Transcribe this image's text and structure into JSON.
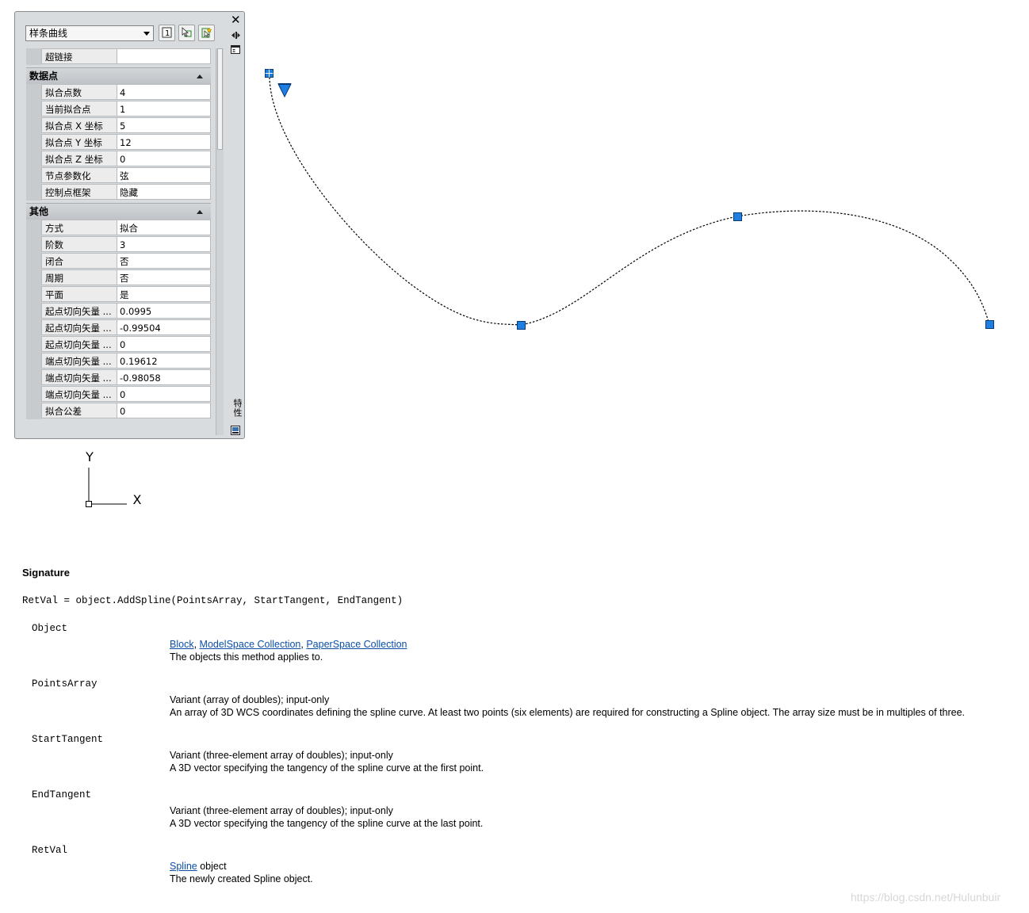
{
  "palette": {
    "object_type": "样条曲线",
    "title": "特性",
    "general_rows": [
      {
        "key": "超链接",
        "value": ""
      }
    ],
    "categories": [
      {
        "name": "数据点",
        "rows": [
          {
            "key": "拟合点数",
            "value": "4"
          },
          {
            "key": "当前拟合点",
            "value": "1"
          },
          {
            "key": "拟合点 X 坐标",
            "value": "5"
          },
          {
            "key": "拟合点 Y 坐标",
            "value": "12"
          },
          {
            "key": "拟合点 Z 坐标",
            "value": "0"
          },
          {
            "key": "节点参数化",
            "value": "弦"
          },
          {
            "key": "控制点框架",
            "value": "隐藏"
          }
        ]
      },
      {
        "name": "其他",
        "rows": [
          {
            "key": "方式",
            "value": "拟合"
          },
          {
            "key": "阶数",
            "value": "3"
          },
          {
            "key": "闭合",
            "value": "否"
          },
          {
            "key": "周期",
            "value": "否"
          },
          {
            "key": "平面",
            "value": "是"
          },
          {
            "key": "起点切向矢量 ...",
            "value": "0.0995"
          },
          {
            "key": "起点切向矢量 ...",
            "value": "-0.99504"
          },
          {
            "key": "起点切向矢量 ...",
            "value": "0"
          },
          {
            "key": "端点切向矢量 ...",
            "value": "0.19612"
          },
          {
            "key": "端点切向矢量 ...",
            "value": "-0.98058"
          },
          {
            "key": "端点切向矢量 ...",
            "value": "0"
          },
          {
            "key": "拟合公差",
            "value": "0"
          }
        ]
      }
    ],
    "icons": [
      "pickadd-toggle-icon",
      "select-objects-icon",
      "quick-select-icon",
      "close-icon",
      "autohide-icon",
      "properties-menu-icon"
    ]
  },
  "ucs": {
    "x_label": "X",
    "y_label": "Y"
  },
  "doc": {
    "heading": "Signature",
    "syntax": "RetVal = object.AddSpline(PointsArray, StartTangent, EndTangent)",
    "params": [
      {
        "name": "Object",
        "links": [
          "Block",
          "ModelSpace Collection",
          "PaperSpace Collection"
        ],
        "line2": "The objects this method applies to."
      },
      {
        "name": "PointsArray",
        "line1": "Variant (array of doubles); input-only",
        "line2": "An array of 3D WCS coordinates defining the spline curve. At least two points (six elements) are required for constructing a Spline object. The array size must be in multiples of three."
      },
      {
        "name": "StartTangent",
        "line1": "Variant (three-element array of doubles); input-only",
        "line2": "A 3D vector specifying the tangency of the spline curve at the first point."
      },
      {
        "name": "EndTangent",
        "line1": "Variant (three-element array of doubles); input-only",
        "line2": "A 3D vector specifying the tangency of the spline curve at the last point."
      },
      {
        "name": "RetVal",
        "link": "Spline",
        "line1_suffix": " object",
        "line2": "The newly created Spline object."
      }
    ]
  },
  "watermark": "https://blog.csdn.net/Hulunbuir",
  "colors": {
    "grip": "#1e7fe0",
    "palette_bg": "#d9dcde",
    "link": "#0b4fa8"
  }
}
